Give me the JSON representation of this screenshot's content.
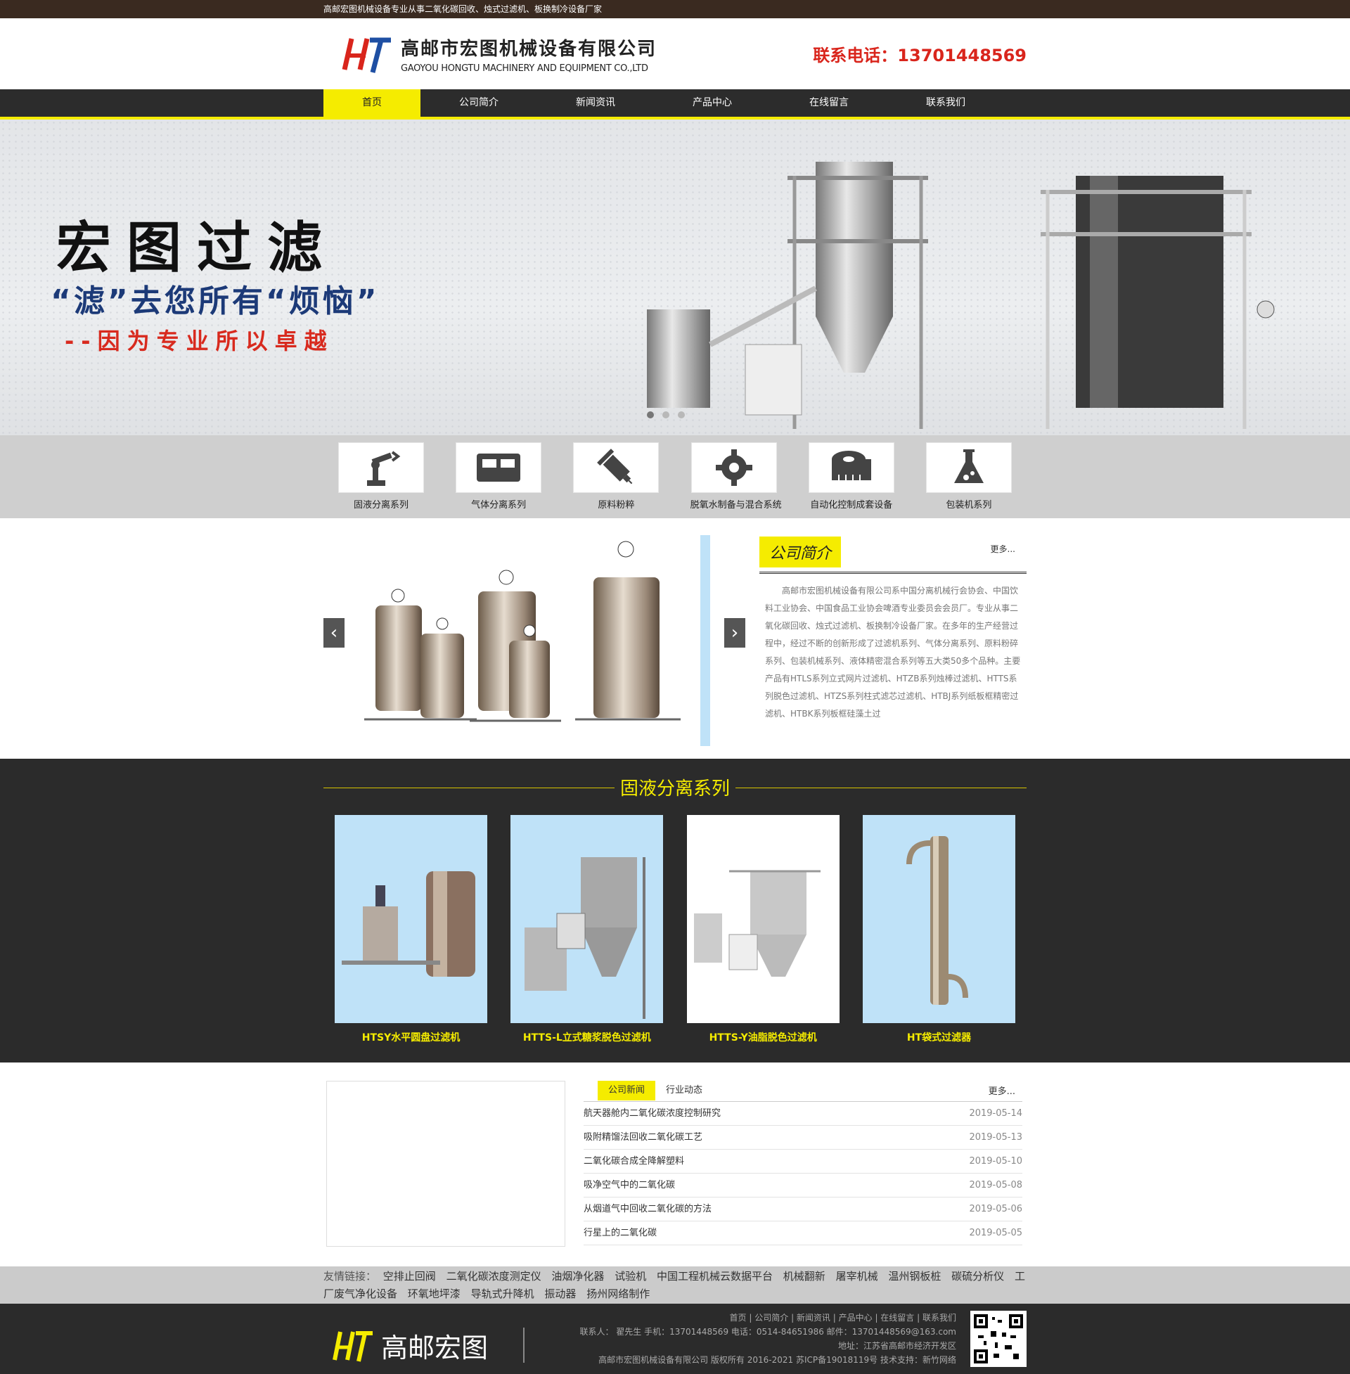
{
  "topbar": {
    "text": "高邮宏图机械设备专业从事二氧化碳回收、烛式过滤机、板换制冷设备厂家"
  },
  "header": {
    "company_cn": "高邮市宏图机械设备有限公司",
    "company_en": "GAOYOU HONGTU MACHINERY AND EQUIPMENT CO.,LTD",
    "hotline": "联系电话：13701448569",
    "brand_colors": {
      "accent": "#f5ec00",
      "red": "#d9251c",
      "blue": "#1e4fa3"
    }
  },
  "nav": {
    "items": [
      "首页",
      "公司简介",
      "新闻资讯",
      "产品中心",
      "在线留言",
      "联系我们"
    ],
    "active": "首页"
  },
  "banner": {
    "title": "宏图过滤",
    "subtitle": "“滤”去您所有“烦恼”",
    "tagline": "--因为专业所以卓越",
    "slides": 3,
    "active_slide": 1
  },
  "categories": [
    {
      "label": "固液分离系列",
      "icon": "robot-arm-icon"
    },
    {
      "label": "气体分离系列",
      "icon": "bed-icon"
    },
    {
      "label": "原料粉粹",
      "icon": "syringe-icon"
    },
    {
      "label": "脱氧水制备与混合系统",
      "icon": "gear-icon"
    },
    {
      "label": "自动化控制成套设备",
      "icon": "tape-measure-icon"
    },
    {
      "label": "包装机系列",
      "icon": "flask-icon"
    }
  ],
  "about": {
    "title": "公司简介",
    "more": "更多...",
    "body": "高邮市宏图机械设备有限公司系中国分离机械行会协会、中国饮料工业协会、中国食品工业协会啤酒专业委员会会员厂。专业从事二氧化碳回收、烛式过滤机、板换制冷设备厂家。在多年的生产经营过程中，经过不断的创新形成了过滤机系列、气体分离系列、原料粉碎系列、包装机械系列、液体精密混合系列等五大类50多个品种。主要产品有HTLS系列立式网片过滤机、HTZB系列烛棒过滤机、HTTS系列脱色过滤机、HTZS系列柱式滤芯过滤机、HTBJ系列纸板框精密过滤机、HTBK系列板框硅藻土过",
    "prev": "‹",
    "next": "›"
  },
  "products": {
    "title": "固液分离系列",
    "items": [
      {
        "name": "HTSY水平圆盘过滤机"
      },
      {
        "name": "HTTS-L立式糖浆脱色过滤机"
      },
      {
        "name": "HTTS-Y油脂脱色过滤机"
      },
      {
        "name": "HT袋式过滤器"
      }
    ]
  },
  "news": {
    "tabs": [
      "公司新闻",
      "行业动态"
    ],
    "active_tab": "公司新闻",
    "more": "更多...",
    "rows": [
      {
        "title": "航天器舱内二氧化碳浓度控制研究",
        "date": "2019-05-14"
      },
      {
        "title": "吸附精馏法回收二氧化碳工艺",
        "date": "2019-05-13"
      },
      {
        "title": "二氧化碳合成全降解塑料",
        "date": "2019-05-10"
      },
      {
        "title": "吸净空气中的二氧化碳",
        "date": "2019-05-08"
      },
      {
        "title": "从烟道气中回收二氧化碳的方法",
        "date": "2019-05-06"
      },
      {
        "title": "行星上的二氧化碳",
        "date": "2019-05-05"
      }
    ]
  },
  "links": {
    "label": "友情链接：",
    "items": [
      "空排止回阀",
      "二氧化碳浓度测定仪",
      "油烟净化器",
      "试验机",
      "中国工程机械云数据平台",
      "机械翻新",
      "屠宰机械",
      "温州钢板桩",
      "碳硫分析仪",
      "工厂废气净化设备",
      "环氧地坪漆",
      "导轨式升降机",
      "振动器",
      "扬州网络制作"
    ]
  },
  "footer": {
    "brand": "高邮宏图",
    "nav": [
      "首页",
      "公司简介",
      "新闻资讯",
      "产品中心",
      "在线留言",
      "联系我们"
    ],
    "contact_line": "联系人： 翟先生    手机：13701448569    电话：0514-84651986    邮件：13701448569@163.com",
    "address": "地址：江苏省高邮市经济开发区",
    "copyright": "高邮市宏图机械设备有限公司  版权所有 2016-2021 苏ICP备19018119号  技术支持：新竹网络"
  }
}
